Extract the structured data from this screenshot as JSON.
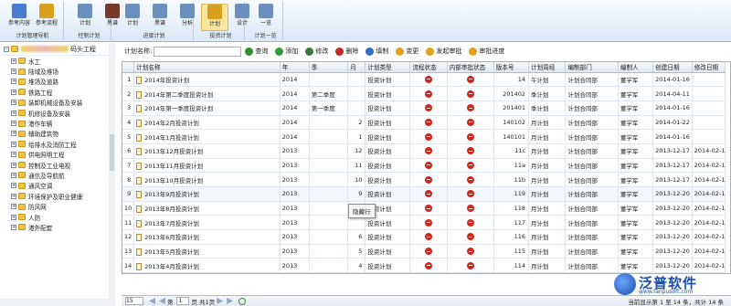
{
  "ribbon": {
    "groups": [
      {
        "caption": "计划管理导航",
        "buttons": [
          {
            "label": "参考内容",
            "icon": "reference-icon",
            "color": "#4a7bd1"
          },
          {
            "label": "参考流程",
            "icon": "flow-icon",
            "color": "#d9a020"
          }
        ]
      },
      {
        "caption": "控制计划",
        "buttons": [
          {
            "label": "计划",
            "icon": "plan-icon",
            "color": "#6b8fbf"
          },
          {
            "label": "黑谱",
            "icon": "book-icon",
            "color": "#7a3a2a"
          }
        ]
      },
      {
        "caption": "进度计划",
        "buttons": [
          {
            "label": "计划",
            "icon": "plan-icon",
            "color": "#6b8fbf"
          },
          {
            "label": "黑谱",
            "icon": "grid-icon",
            "color": "#6b8fbf"
          },
          {
            "label": "分析",
            "icon": "analysis-icon",
            "color": "#6b8fbf"
          }
        ]
      },
      {
        "caption": "投资计划",
        "buttons": [
          {
            "label": "计划",
            "icon": "plan-icon",
            "color": "#d9a020",
            "selected": true
          },
          {
            "label": "设计",
            "icon": "design-icon",
            "color": "#6b8fbf"
          }
        ]
      },
      {
        "caption": "计划一览",
        "buttons": [
          {
            "label": "一览",
            "icon": "overview-icon",
            "color": "#6b8fbf"
          }
        ]
      }
    ]
  },
  "tree": {
    "root_label": "码头工程",
    "items": [
      "水工",
      "陆域及堆场",
      "堆场及道路",
      "铁路工程",
      "装卸机械设备及安装",
      "机修设备及安装",
      "港作车辆",
      "辅助建筑物",
      "给排水及消防工程",
      "供电照明工程",
      "控制及工业电视",
      "通信及导航航",
      "通风空调",
      "环境保护及职业健康",
      "防风网",
      "人防",
      "港外配套"
    ]
  },
  "toolbar": {
    "search_label": "计划名称:",
    "search_value": "",
    "buttons": [
      {
        "label": "查询",
        "icon": "search-icon",
        "color": "#2f8f2f"
      },
      {
        "label": "添加",
        "icon": "add-icon",
        "color": "#2f9a3a"
      },
      {
        "label": "修改",
        "icon": "edit-icon",
        "color": "#3a7a3a"
      },
      {
        "label": "删除",
        "icon": "delete-icon",
        "color": "#c62828"
      },
      {
        "label": "填制",
        "icon": "fill-icon",
        "color": "#2f6fc6"
      },
      {
        "label": "变更",
        "icon": "change-icon",
        "color": "#e0a020"
      },
      {
        "label": "发起审批",
        "icon": "approve-icon",
        "color": "#e0a020"
      },
      {
        "label": "审批进度",
        "icon": "progress-icon",
        "color": "#e0a020"
      }
    ]
  },
  "table": {
    "columns": [
      "",
      "计划名称",
      "年",
      "季",
      "月",
      "计划类型",
      "流程状态",
      "内部审批状态",
      "版本号",
      "计划周经",
      "编制部门",
      "编制人",
      "创建日期",
      "修改日期"
    ],
    "rows": [
      [
        "1",
        "2014年投资计划",
        "2014",
        "",
        "",
        "投资计划",
        "stop",
        "stop",
        "14",
        "午计划",
        "计划合同部",
        "董学军",
        "2014-01-16",
        ""
      ],
      [
        "2",
        "2014年第二季度投资计划",
        "2014",
        "第二季度",
        "",
        "投资计划",
        "stop",
        "stop",
        "201402",
        "季计划",
        "计划合同部",
        "董学军",
        "2014-04-11",
        ""
      ],
      [
        "3",
        "2014年第一季度投资计划",
        "2014",
        "第一季度",
        "",
        "投资计划",
        "stop",
        "stop",
        "201401",
        "季计划",
        "计划合同部",
        "董学军",
        "2014-01-16",
        ""
      ],
      [
        "4",
        "2014年2月投资计划",
        "2014",
        "",
        "2",
        "投资计划",
        "stop",
        "stop",
        "140102",
        "月计划",
        "计划合同部",
        "董学军",
        "2014-01-22",
        ""
      ],
      [
        "5",
        "2014年1月投资计划",
        "2014",
        "",
        "1",
        "投资计划",
        "stop",
        "stop",
        "140101",
        "月计划",
        "计划合同部",
        "董学军",
        "2014-01-16",
        ""
      ],
      [
        "6",
        "2013年12月投资计划",
        "2013",
        "",
        "12",
        "投资计划",
        "stop",
        "stop",
        "11c",
        "月计划",
        "计划合同部",
        "董学军",
        "2013-12-17",
        "2014-02-17"
      ],
      [
        "7",
        "2013年11月投资计划",
        "2013",
        "",
        "11",
        "投资计划",
        "stop",
        "stop",
        "11a",
        "月计划",
        "计划合同部",
        "董学军",
        "2013-12-17",
        "2014-02-17"
      ],
      [
        "8",
        "2013年10月投资计划",
        "2013",
        "",
        "10",
        "投资计划",
        "stop",
        "stop",
        "11b",
        "月计划",
        "计划合同部",
        "董学军",
        "2013-12-17",
        "2014-02-17"
      ],
      [
        "9",
        "2013年9月投资计划",
        "2013",
        "",
        "9",
        "投资计划",
        "stop",
        "stop",
        "119",
        "月计划",
        "计划合同部",
        "董学军",
        "2013-12-20",
        "2014-02-17"
      ],
      [
        "10",
        "2013年8月投资计划",
        "2013",
        "",
        "",
        "投资计划",
        "stop",
        "stop",
        "118",
        "月计划",
        "计划合同部",
        "董学军",
        "2013-12-20",
        "2014-02-17"
      ],
      [
        "11",
        "2013年7月投资计划",
        "2013",
        "",
        "",
        "投资计划",
        "stop",
        "stop",
        "117",
        "月计划",
        "计划合同部",
        "董学军",
        "2013-12-20",
        "2014-02-17"
      ],
      [
        "12",
        "2013年6月投资计划",
        "2013",
        "",
        "6",
        "投资计划",
        "stop",
        "stop",
        "116",
        "月计划",
        "计划合同部",
        "董学军",
        "2013-12-20",
        "2014-02-17"
      ],
      [
        "13",
        "2013年5月投资计划",
        "2013",
        "",
        "5",
        "投资计划",
        "stop",
        "stop",
        "115",
        "月计划",
        "计划合同部",
        "董学军",
        "2013-12-20",
        "2014-02-17"
      ],
      [
        "14",
        "2013年4月投资计划",
        "2013",
        "",
        "4",
        "投资计划",
        "stop",
        "stop",
        "114",
        "月计划",
        "计划合同部",
        "董学军",
        "2013-12-20",
        "2014-02-17"
      ]
    ],
    "tooltip": "隐藏行"
  },
  "pager": {
    "page_size": "15",
    "page_label_pre": "第",
    "page_value": "1",
    "page_label_post": "页 共1页",
    "info": "当前显示第 1 至 14 条，共计 14 条"
  },
  "logo": {
    "name": "泛普软件",
    "url": "www.fanpusoft.com"
  }
}
